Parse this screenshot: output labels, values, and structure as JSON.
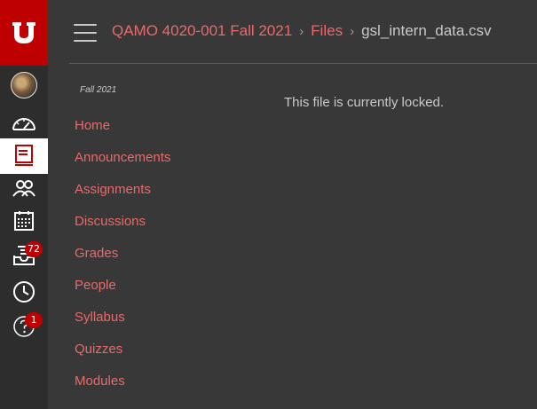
{
  "breadcrumb": {
    "course": "QAMO 4020-001 Fall 2021",
    "files": "Files",
    "current": "gsl_intern_data.csv",
    "separator": "›"
  },
  "global_nav": {
    "items": [
      {
        "name": "account",
        "icon": "avatar-icon"
      },
      {
        "name": "dashboard",
        "icon": "dashboard-icon"
      },
      {
        "name": "courses",
        "icon": "courses-icon",
        "active": true
      },
      {
        "name": "groups",
        "icon": "groups-icon"
      },
      {
        "name": "calendar",
        "icon": "calendar-icon"
      },
      {
        "name": "inbox",
        "icon": "inbox-icon",
        "badge": "72"
      },
      {
        "name": "history",
        "icon": "history-icon"
      },
      {
        "name": "help",
        "icon": "help-icon",
        "badge": "1"
      }
    ]
  },
  "course_nav": {
    "term": "Fall 2021",
    "links": [
      "Home",
      "Announcements",
      "Assignments",
      "Discussions",
      "Grades",
      "People",
      "Syllabus",
      "Quizzes",
      "Modules"
    ]
  },
  "content": {
    "message": "This file is currently locked."
  },
  "colors": {
    "brand": "#be0000",
    "link": "#e96a6a",
    "text": "#c9c9c9",
    "background": "#383838",
    "global_nav": "#2d2d2d"
  }
}
